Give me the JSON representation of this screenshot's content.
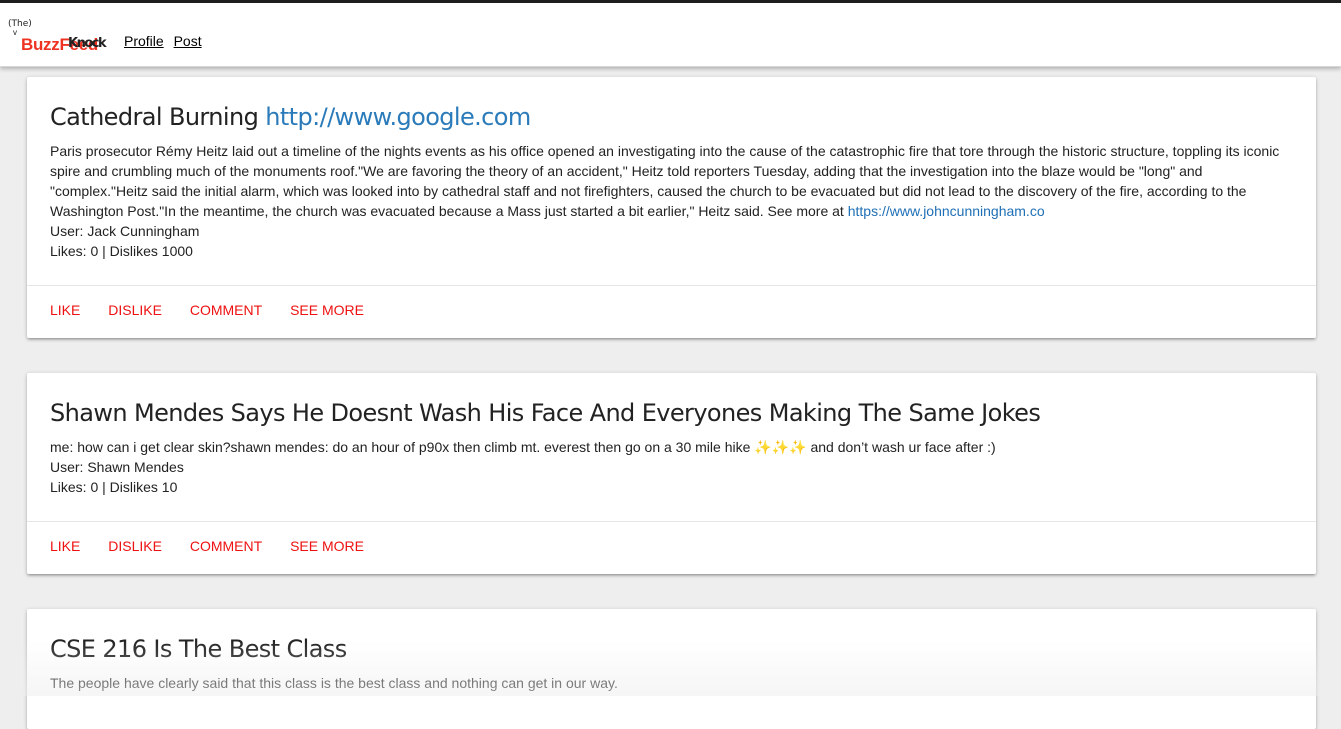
{
  "nav": {
    "logo_the": "(The)",
    "logo_buzz": "BuzzFeed",
    "logo_scribble": "Knock",
    "links": [
      "Profile",
      "Post"
    ]
  },
  "posts": [
    {
      "title": "Cathedral Burning",
      "title_link": "http://www.google.com",
      "body": "Paris prosecutor Rémy Heitz laid out a timeline of the nights events as his office opened an investigating into the cause of the catastrophic fire that tore through the historic structure, toppling its iconic spire and crumbling much of the monuments roof.\"We are favoring the theory of an accident,\" Heitz told reporters Tuesday, adding that the investigation into the blaze would be \"long\" and \"complex.\"Heitz said the initial alarm, which was looked into by cathedral staff and not firefighters, caused the church to be evacuated but did not lead to the discovery of the fire, according to the Washington Post.\"In the meantime, the church was evacuated because a Mass just started a bit earlier,\" Heitz said. See more at ",
      "body_link": "https://www.johncunningham.co",
      "user": "User: Jack Cunningham",
      "likes": "Likes: 0 | Dislikes 1000"
    },
    {
      "title": "Shawn Mendes Says He Doesnt Wash His Face And Everyones Making The Same Jokes",
      "body": "me: how can i get clear skin?shawn mendes: do an hour of p90x then climb mt. everest then go on a 30 mile hike ✨✨✨ and don’t wash ur face after :)",
      "user": "User: Shawn Mendes",
      "likes": "Likes: 0 | Dislikes 10"
    },
    {
      "title": "CSE 216 Is The Best Class",
      "body": "The people have clearly said that this class is the best class and nothing can get in our way."
    }
  ],
  "actions": {
    "like": "LIKE",
    "dislike": "DISLIKE",
    "comment": "COMMENT",
    "see_more": "SEE MORE"
  },
  "colors": {
    "accent_red": "#ee1111",
    "link_blue": "#2b7bba",
    "background": "#eeeeee"
  }
}
